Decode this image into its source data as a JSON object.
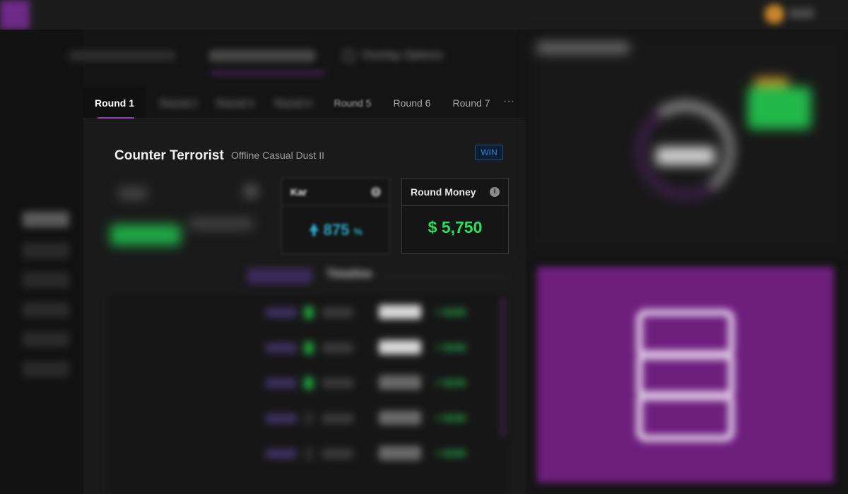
{
  "header": {
    "overlay_options_label": "Overlay Options"
  },
  "round_tabs": {
    "active": "Round 1",
    "items": [
      "Round 2",
      "Round 3",
      "Round 4",
      "Round 5",
      "Round 6",
      "Round 7"
    ],
    "more": "···"
  },
  "card": {
    "title": "Counter Terrorist",
    "subtitle": "Offline Casual Dust II",
    "result_badge": "WIN"
  },
  "stats": {
    "kar": {
      "label": "Kar",
      "value": "875",
      "unit": "%"
    },
    "round_money": {
      "label": "Round Money",
      "currency": "$",
      "value": "5,750"
    }
  },
  "timeline": {
    "title": "Timeline",
    "rows": [
      {
        "amount": "+ $150"
      },
      {
        "amount": "+ $150"
      },
      {
        "amount": "+ $150"
      },
      {
        "amount": "+ $150"
      },
      {
        "amount": "+ $150"
      }
    ]
  },
  "colors": {
    "accent": "#8e3bb0",
    "money_green": "#28e05a",
    "win_blue": "#3a7bd5",
    "teal": "#2aa7c6"
  }
}
